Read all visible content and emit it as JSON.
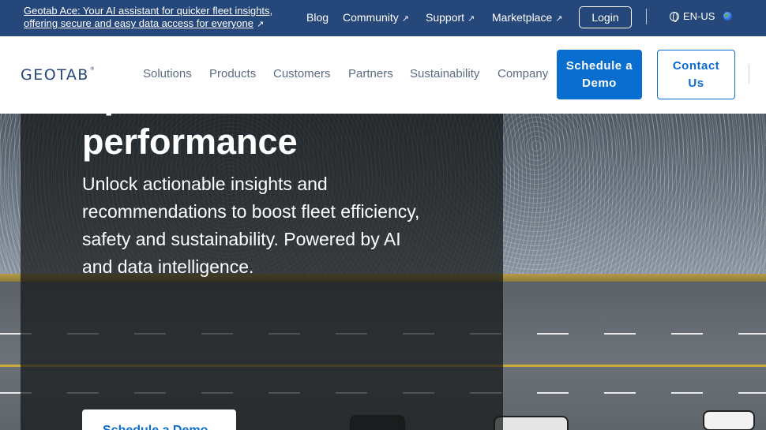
{
  "topbar": {
    "ace_line1": "Geotab Ace: Your AI assistant for quicker fleet insights,",
    "ace_line2": "offering secure and easy data access for everyone",
    "links": [
      {
        "label": "Blog",
        "external": false
      },
      {
        "label": "Community",
        "external": true
      },
      {
        "label": "Support",
        "external": true
      },
      {
        "label": "Marketplace",
        "external": true
      }
    ],
    "login": "Login",
    "language": "EN-US"
  },
  "nav": {
    "logo": "GEOTAB",
    "logo_mark": "®",
    "items": [
      "Solutions",
      "Products",
      "Customers",
      "Partners",
      "Sustainability",
      "Company"
    ],
    "schedule_demo": "Schedule a Demo",
    "contact_us": "Contact Us"
  },
  "hero": {
    "title": "One platform for optimal fleet performance",
    "subtitle": "Unlock actionable insights and recommendations to boost fleet efficiency, safety and sustainability. Powered by AI and data intelligence.",
    "cta": "Schedule a Demo"
  },
  "colors": {
    "topbar_bg": "#25477a",
    "primary": "#0a6ed1",
    "nav_text": "#5b6b82"
  },
  "icons": {
    "external": "external-link-icon",
    "globe": "globe-icon",
    "flag": "earth-icon"
  }
}
